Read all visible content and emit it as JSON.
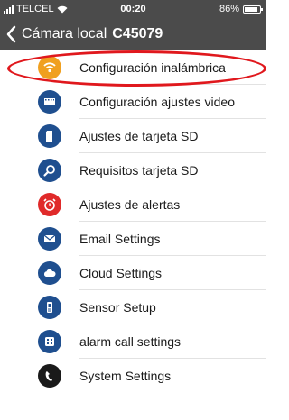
{
  "status_bar": {
    "carrier": "TELCEL",
    "time": "00:20",
    "battery_percent": "86%",
    "battery_level": 0.86
  },
  "nav": {
    "back_label": "Cámara local",
    "device_code": "C45079"
  },
  "menu": [
    {
      "label": "Configuración inalámbrica",
      "icon": "wifi-icon",
      "color": "#f0a020"
    },
    {
      "label": "Configuración ajustes video",
      "icon": "film-icon",
      "color": "#1f4f8f"
    },
    {
      "label": "Ajustes de tarjeta SD",
      "icon": "sd-card-icon",
      "color": "#1f4f8f"
    },
    {
      "label": "Requisitos tarjeta SD",
      "icon": "magnifier-icon",
      "color": "#1f4f8f"
    },
    {
      "label": "Ajustes de alertas",
      "icon": "alarm-clock-icon",
      "color": "#e02a2a"
    },
    {
      "label": "Email Settings",
      "icon": "envelope-icon",
      "color": "#1f4f8f"
    },
    {
      "label": "Cloud Settings",
      "icon": "cloud-icon",
      "color": "#1f4f8f"
    },
    {
      "label": "Sensor Setup",
      "icon": "sensor-icon",
      "color": "#1f4f8f"
    },
    {
      "label": "alarm call settings",
      "icon": "phone-keypad-icon",
      "color": "#1f4f8f"
    },
    {
      "label": "System Settings",
      "icon": "phone-handset-icon",
      "color": "#1a1a1a"
    }
  ],
  "annotation": {
    "highlight_color": "#e0181d",
    "highlighted_item": "Configuración inalámbrica"
  }
}
